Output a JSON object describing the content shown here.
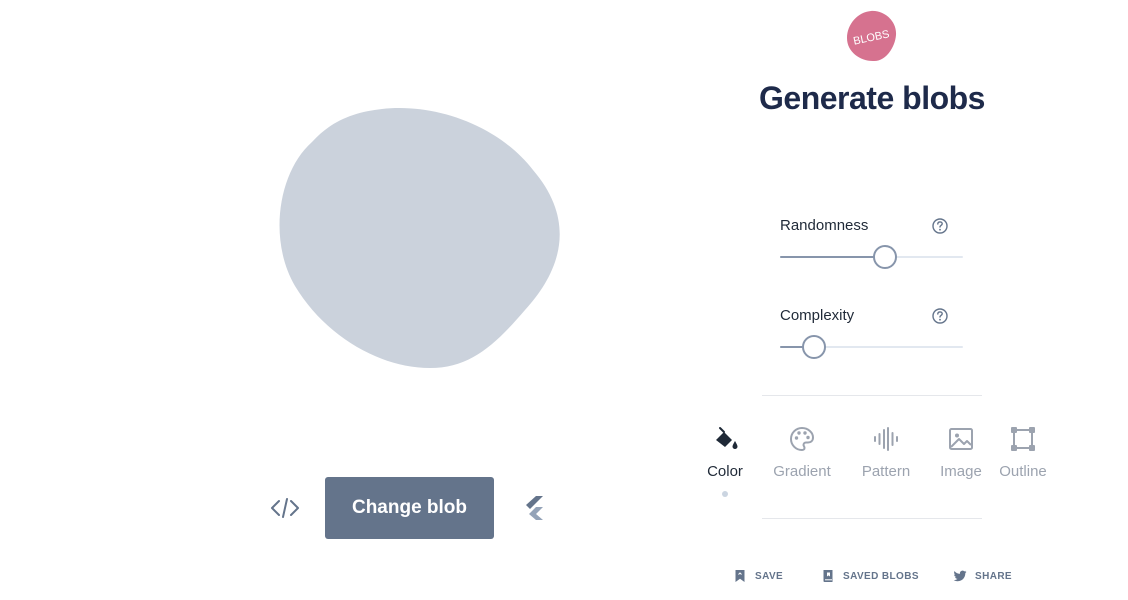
{
  "header": {
    "logo_text": "BLOBS",
    "title": "Generate blobs"
  },
  "blob": {
    "fill": "#cbd2dc"
  },
  "controls": {
    "code_icon": "code-icon",
    "change_label": "Change blob",
    "flutter_icon": "flutter-icon"
  },
  "sliders": {
    "randomness": {
      "label": "Randomness",
      "value": 0.57,
      "help_icon": "question-circle-icon"
    },
    "complexity": {
      "label": "Complexity",
      "value": 0.18,
      "help_icon": "question-circle-icon"
    }
  },
  "tabs": [
    {
      "label": "Color",
      "icon": "paint-bucket-icon",
      "active": true
    },
    {
      "label": "Gradient",
      "icon": "palette-icon",
      "active": false
    },
    {
      "label": "Pattern",
      "icon": "waveform-icon",
      "active": false
    },
    {
      "label": "Image",
      "icon": "image-icon",
      "active": false
    },
    {
      "label": "Outline",
      "icon": "outline-icon",
      "active": false
    }
  ],
  "actions": {
    "save": "SAVE",
    "saved_blobs": "SAVED BLOBS",
    "share": "SHARE"
  },
  "colors": {
    "accent": "#64748b",
    "title": "#1e2a4a",
    "logo": "#d6728f",
    "slider": "#8795ab"
  }
}
